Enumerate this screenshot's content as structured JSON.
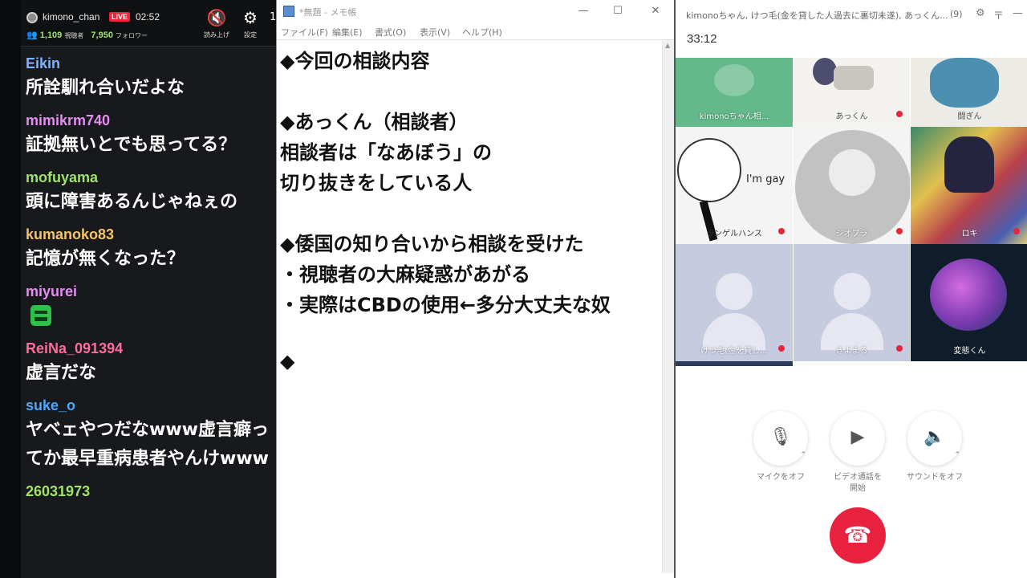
{
  "stream": {
    "channel": "kimono_chan",
    "live_badge": "LIVE",
    "time": "02:52",
    "viewers": "1,109",
    "viewers_label": "視聴者",
    "followers": "7,950",
    "followers_label": "フォロワー",
    "read_aloud_label": "読み上げ",
    "settings_label": "設定",
    "edge_char": "1"
  },
  "chat": [
    {
      "user": "Eikin",
      "color": "#7fb3ff",
      "text": "所詮馴れ合いだよな"
    },
    {
      "user": "mimikrm740",
      "color": "#e58cf0",
      "text": "証拠無いとでも思ってる？"
    },
    {
      "user": "mofuyama",
      "color": "#9fe36b",
      "text": "頭に障害あるんじゃねぇの"
    },
    {
      "user": "kumanoko83",
      "color": "#f2c46b",
      "text": "記憶が無くなった？"
    },
    {
      "user": "miyurei",
      "color": "#e58cf0",
      "text": "",
      "emote": "green-face-emote"
    },
    {
      "user": "ReiNa_091394",
      "color": "#ff6b9a",
      "text": "虚言だな"
    },
    {
      "user": "suke_o",
      "color": "#4aa8ff",
      "text": "ヤベェやつだなwww虚言癖ってか最早重病患者やんけwww"
    },
    {
      "user": "26031973",
      "color": "#9fe36b",
      "text": ""
    }
  ],
  "notepad": {
    "title": "*無題 - メモ帳",
    "minimize": "—",
    "maximize": "☐",
    "close": "✕",
    "menu": [
      "ファイル(F)",
      "編集(E)",
      "書式(O)",
      "表示(V)",
      "ヘルプ(H)"
    ],
    "lines": [
      "◆今回の相談内容",
      "",
      "◆あっくん（相談者）",
      "相談者は「なあぼう」の",
      "切り抜きをしている人",
      "",
      "◆倭国の知り合いから相談を受けた",
      "・視聴者の大麻疑惑があがる",
      "・実際はCBDの使用←多分大丈夫な奴",
      "",
      "◆"
    ]
  },
  "call": {
    "title": "kimonoちゃん, けつ毛(金を貸した人過去に裏切未遂), あっくん...",
    "count": "(9)",
    "timer": "33:12",
    "participants": [
      {
        "name": "kimonoちゃん相...",
        "muted": false
      },
      {
        "name": "あっくん",
        "muted": true
      },
      {
        "name": "闘ぎん",
        "muted": true
      },
      {
        "name": "ランゲルハンス",
        "muted": true,
        "caption": "I'm gay"
      },
      {
        "name": "ジオブラ",
        "muted": true
      },
      {
        "name": "ロキ",
        "muted": true
      },
      {
        "name": "けつ毛(金を貸し...",
        "muted": true
      },
      {
        "name": "きよまる",
        "muted": true
      },
      {
        "name": "変態くん",
        "muted": false
      }
    ],
    "controls": [
      {
        "label": "マイクをオフ",
        "icon": "microphone-icon"
      },
      {
        "label": "ビデオ通話を開始",
        "icon": "video-camera-icon"
      },
      {
        "label": "サウンドをオフ",
        "icon": "speaker-icon"
      }
    ],
    "hangup_icon": "phone-hangup-icon"
  }
}
